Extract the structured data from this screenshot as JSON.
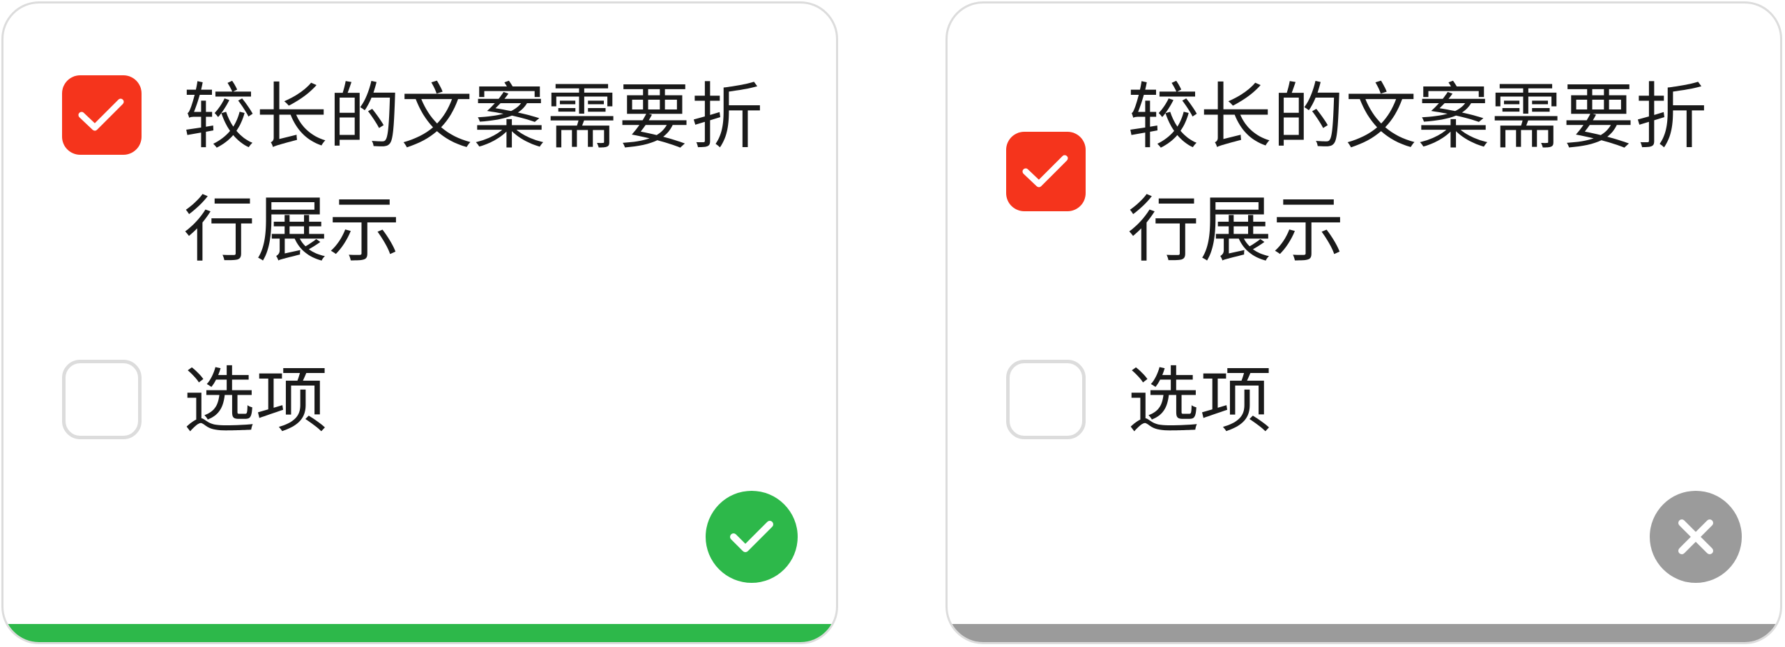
{
  "colors": {
    "checked_fill": "#f5341c",
    "unchecked_border": "#dcdcdc",
    "correct": "#2db84a",
    "incorrect": "#9b9b9b"
  },
  "cards": [
    {
      "result": "correct",
      "result_icon": "check-icon",
      "options": [
        {
          "label": "较长的文案需要折行展示",
          "checked": true
        },
        {
          "label": "选项",
          "checked": false
        }
      ]
    },
    {
      "result": "incorrect",
      "result_icon": "close-icon",
      "options": [
        {
          "label": "较长的文案需要折行展示",
          "checked": true
        },
        {
          "label": "选项",
          "checked": false
        }
      ]
    }
  ]
}
